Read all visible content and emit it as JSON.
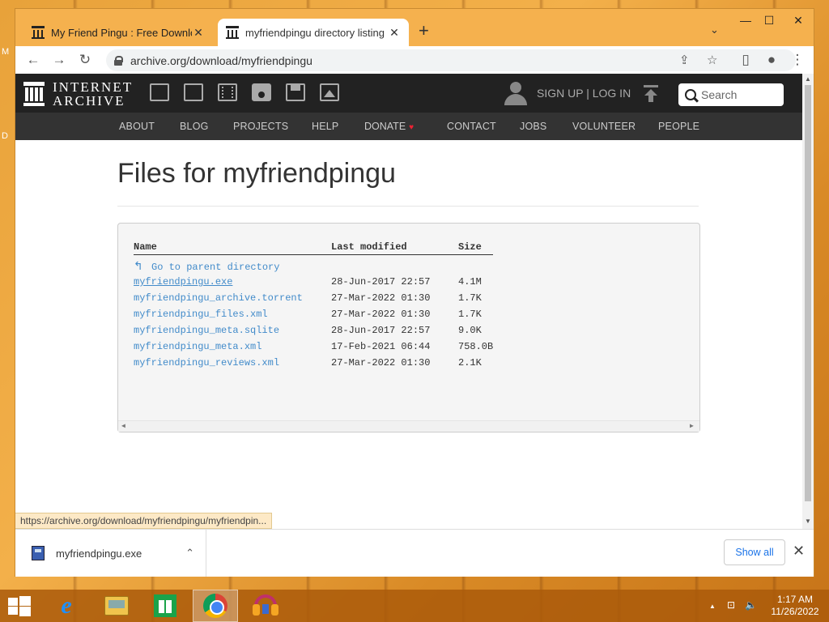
{
  "desktop": {
    "letters": [
      "M",
      "D"
    ]
  },
  "window_controls": {
    "minimize": "—",
    "maximize": "☐",
    "close": "✕"
  },
  "tabs": [
    {
      "label": "My Friend Pingu : Free Downloac",
      "close": "✕"
    },
    {
      "label": "myfriendpingu directory listing",
      "close": "✕"
    }
  ],
  "new_tab": "+",
  "tab_menu": "⌄",
  "toolbar": {
    "back": "←",
    "forward": "→",
    "reload": "↻",
    "url": "archive.org/download/myfriendpingu",
    "share": "⇪",
    "bookmark": "☆",
    "sidepanel": "▯",
    "profile": "●",
    "menu": "⋮"
  },
  "ia_header": {
    "logo_line1": "INTERNET",
    "logo_line2": "ARCHIVE",
    "signup": "SIGN UP | LOG IN",
    "search_placeholder": "Search"
  },
  "ia_nav": [
    "ABOUT",
    "BLOG",
    "PROJECTS",
    "HELP",
    "DONATE",
    "CONTACT",
    "JOBS",
    "VOLUNTEER",
    "PEOPLE"
  ],
  "donate_heart": "♥",
  "page": {
    "title": "Files for myfriendpingu",
    "columns": {
      "name": "Name",
      "modified": "Last modified",
      "size": "Size"
    },
    "parent": "Go to parent directory",
    "parent_arrow": "↰",
    "files": [
      {
        "name": "myfriendpingu.exe",
        "modified": "28-Jun-2017 22:57",
        "size": "4.1M",
        "underlined": true
      },
      {
        "name": "myfriendpingu_archive.torrent",
        "modified": "27-Mar-2022 01:30",
        "size": "1.7K",
        "underlined": false
      },
      {
        "name": "myfriendpingu_files.xml",
        "modified": "27-Mar-2022 01:30",
        "size": "1.7K",
        "underlined": false
      },
      {
        "name": "myfriendpingu_meta.sqlite",
        "modified": "28-Jun-2017 22:57",
        "size": "9.0K",
        "underlined": false
      },
      {
        "name": "myfriendpingu_meta.xml",
        "modified": "17-Feb-2021 06:44",
        "size": "758.0B",
        "underlined": false
      },
      {
        "name": "myfriendpingu_reviews.xml",
        "modified": "27-Mar-2022 01:30",
        "size": "2.1K",
        "underlined": false
      }
    ]
  },
  "status_url": "https://archive.org/download/myfriendpingu/myfriendpin...",
  "download_shelf": {
    "filename": "myfriendpingu.exe",
    "chevron": "⌃",
    "show_all": "Show all",
    "close": "✕"
  },
  "taskbar": {
    "ie": "e",
    "tray_chevron": "▲",
    "tray_network": "⊡",
    "tray_volume": "🔈",
    "time": "1:17 AM",
    "date": "11/26/2022"
  },
  "colors": {
    "link": "#428bca",
    "ia_dark": "#222222",
    "accent": "#1a73e8",
    "heart": "#ee2233"
  }
}
